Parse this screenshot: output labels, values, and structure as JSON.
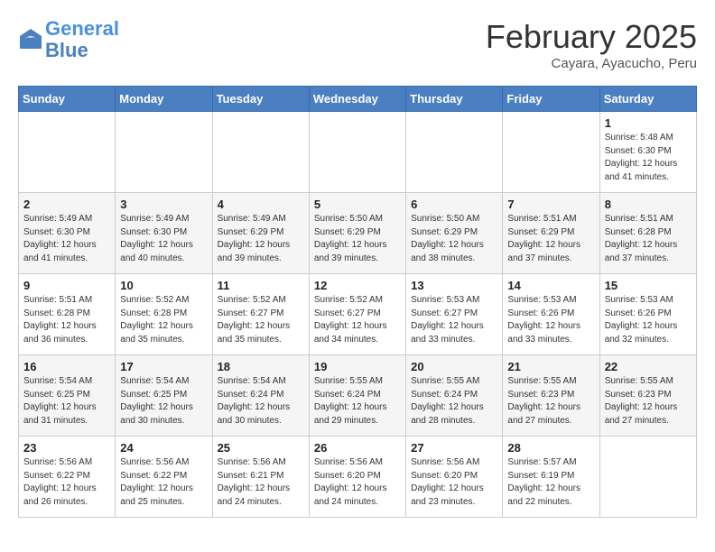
{
  "header": {
    "logo_line1": "General",
    "logo_line2": "Blue",
    "month_title": "February 2025",
    "location": "Cayara, Ayacucho, Peru"
  },
  "weekdays": [
    "Sunday",
    "Monday",
    "Tuesday",
    "Wednesday",
    "Thursday",
    "Friday",
    "Saturday"
  ],
  "weeks": [
    [
      {
        "day": "",
        "info": ""
      },
      {
        "day": "",
        "info": ""
      },
      {
        "day": "",
        "info": ""
      },
      {
        "day": "",
        "info": ""
      },
      {
        "day": "",
        "info": ""
      },
      {
        "day": "",
        "info": ""
      },
      {
        "day": "1",
        "info": "Sunrise: 5:48 AM\nSunset: 6:30 PM\nDaylight: 12 hours\nand 41 minutes."
      }
    ],
    [
      {
        "day": "2",
        "info": "Sunrise: 5:49 AM\nSunset: 6:30 PM\nDaylight: 12 hours\nand 41 minutes."
      },
      {
        "day": "3",
        "info": "Sunrise: 5:49 AM\nSunset: 6:30 PM\nDaylight: 12 hours\nand 40 minutes."
      },
      {
        "day": "4",
        "info": "Sunrise: 5:49 AM\nSunset: 6:29 PM\nDaylight: 12 hours\nand 39 minutes."
      },
      {
        "day": "5",
        "info": "Sunrise: 5:50 AM\nSunset: 6:29 PM\nDaylight: 12 hours\nand 39 minutes."
      },
      {
        "day": "6",
        "info": "Sunrise: 5:50 AM\nSunset: 6:29 PM\nDaylight: 12 hours\nand 38 minutes."
      },
      {
        "day": "7",
        "info": "Sunrise: 5:51 AM\nSunset: 6:29 PM\nDaylight: 12 hours\nand 37 minutes."
      },
      {
        "day": "8",
        "info": "Sunrise: 5:51 AM\nSunset: 6:28 PM\nDaylight: 12 hours\nand 37 minutes."
      }
    ],
    [
      {
        "day": "9",
        "info": "Sunrise: 5:51 AM\nSunset: 6:28 PM\nDaylight: 12 hours\nand 36 minutes."
      },
      {
        "day": "10",
        "info": "Sunrise: 5:52 AM\nSunset: 6:28 PM\nDaylight: 12 hours\nand 35 minutes."
      },
      {
        "day": "11",
        "info": "Sunrise: 5:52 AM\nSunset: 6:27 PM\nDaylight: 12 hours\nand 35 minutes."
      },
      {
        "day": "12",
        "info": "Sunrise: 5:52 AM\nSunset: 6:27 PM\nDaylight: 12 hours\nand 34 minutes."
      },
      {
        "day": "13",
        "info": "Sunrise: 5:53 AM\nSunset: 6:27 PM\nDaylight: 12 hours\nand 33 minutes."
      },
      {
        "day": "14",
        "info": "Sunrise: 5:53 AM\nSunset: 6:26 PM\nDaylight: 12 hours\nand 33 minutes."
      },
      {
        "day": "15",
        "info": "Sunrise: 5:53 AM\nSunset: 6:26 PM\nDaylight: 12 hours\nand 32 minutes."
      }
    ],
    [
      {
        "day": "16",
        "info": "Sunrise: 5:54 AM\nSunset: 6:25 PM\nDaylight: 12 hours\nand 31 minutes."
      },
      {
        "day": "17",
        "info": "Sunrise: 5:54 AM\nSunset: 6:25 PM\nDaylight: 12 hours\nand 30 minutes."
      },
      {
        "day": "18",
        "info": "Sunrise: 5:54 AM\nSunset: 6:24 PM\nDaylight: 12 hours\nand 30 minutes."
      },
      {
        "day": "19",
        "info": "Sunrise: 5:55 AM\nSunset: 6:24 PM\nDaylight: 12 hours\nand 29 minutes."
      },
      {
        "day": "20",
        "info": "Sunrise: 5:55 AM\nSunset: 6:24 PM\nDaylight: 12 hours\nand 28 minutes."
      },
      {
        "day": "21",
        "info": "Sunrise: 5:55 AM\nSunset: 6:23 PM\nDaylight: 12 hours\nand 27 minutes."
      },
      {
        "day": "22",
        "info": "Sunrise: 5:55 AM\nSunset: 6:23 PM\nDaylight: 12 hours\nand 27 minutes."
      }
    ],
    [
      {
        "day": "23",
        "info": "Sunrise: 5:56 AM\nSunset: 6:22 PM\nDaylight: 12 hours\nand 26 minutes."
      },
      {
        "day": "24",
        "info": "Sunrise: 5:56 AM\nSunset: 6:22 PM\nDaylight: 12 hours\nand 25 minutes."
      },
      {
        "day": "25",
        "info": "Sunrise: 5:56 AM\nSunset: 6:21 PM\nDaylight: 12 hours\nand 24 minutes."
      },
      {
        "day": "26",
        "info": "Sunrise: 5:56 AM\nSunset: 6:20 PM\nDaylight: 12 hours\nand 24 minutes."
      },
      {
        "day": "27",
        "info": "Sunrise: 5:56 AM\nSunset: 6:20 PM\nDaylight: 12 hours\nand 23 minutes."
      },
      {
        "day": "28",
        "info": "Sunrise: 5:57 AM\nSunset: 6:19 PM\nDaylight: 12 hours\nand 22 minutes."
      },
      {
        "day": "",
        "info": ""
      }
    ]
  ]
}
